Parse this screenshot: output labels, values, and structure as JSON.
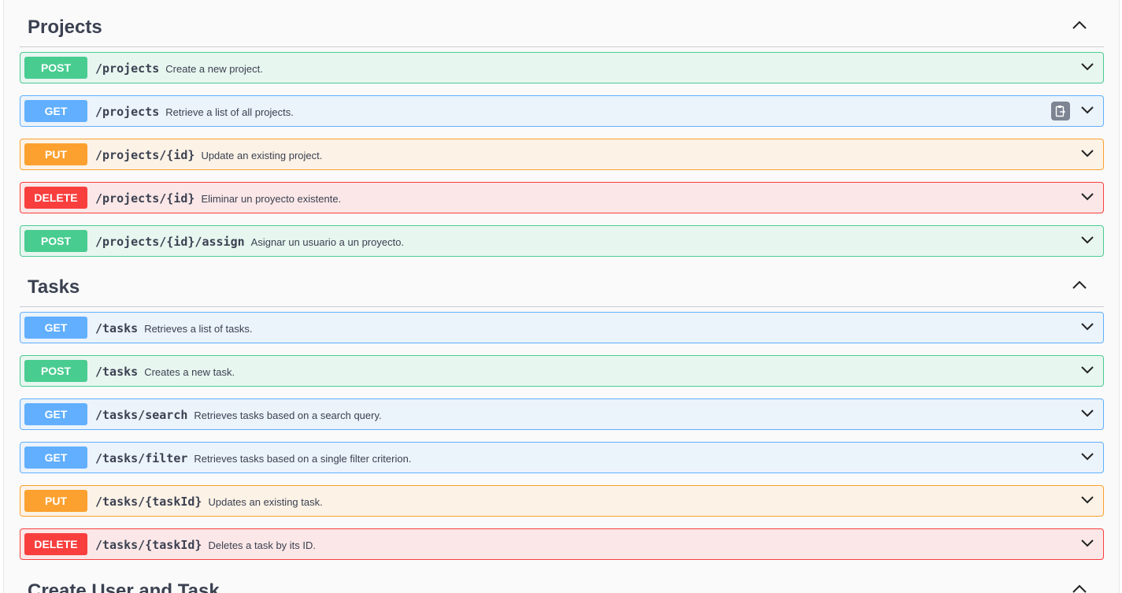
{
  "sections": [
    {
      "title": "Projects",
      "operations": [
        {
          "method": "POST",
          "path": "/projects",
          "summary": "Create a new project."
        },
        {
          "method": "GET",
          "path": "/projects",
          "summary": "Retrieve a list of all projects."
        },
        {
          "method": "PUT",
          "path": "/projects/{id}",
          "summary": "Update an existing project."
        },
        {
          "method": "DELETE",
          "path": "/projects/{id}",
          "summary": "Eliminar un proyecto existente."
        },
        {
          "method": "POST",
          "path": "/projects/{id}/assign",
          "summary": "Asignar un usuario a un proyecto."
        }
      ]
    },
    {
      "title": "Tasks",
      "operations": [
        {
          "method": "GET",
          "path": "/tasks",
          "summary": "Retrieves a list of tasks."
        },
        {
          "method": "POST",
          "path": "/tasks",
          "summary": "Creates a new task."
        },
        {
          "method": "GET",
          "path": "/tasks/search",
          "summary": "Retrieves tasks based on a search query."
        },
        {
          "method": "GET",
          "path": "/tasks/filter",
          "summary": "Retrieves tasks based on a single filter criterion."
        },
        {
          "method": "PUT",
          "path": "/tasks/{taskId}",
          "summary": "Updates an existing task."
        },
        {
          "method": "DELETE",
          "path": "/tasks/{taskId}",
          "summary": "Deletes a task by its ID."
        }
      ]
    },
    {
      "title": "Create User and Task",
      "operations": []
    }
  ],
  "icons": {
    "section_toggle": "chevron-up-icon",
    "operation_toggle": "chevron-down-icon",
    "copy": "clipboard-copy-icon"
  },
  "colors": {
    "post": "#49cc90",
    "get": "#61affe",
    "put": "#fca130",
    "delete": "#f93e3e"
  }
}
